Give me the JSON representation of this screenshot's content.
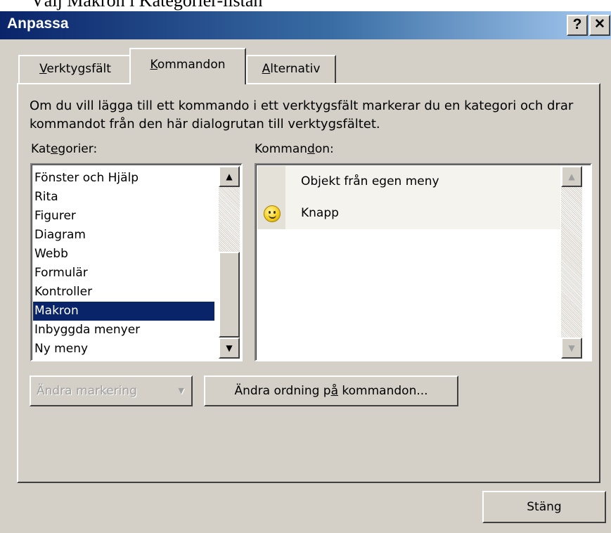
{
  "document": {
    "caption_fragment": "Välj Makron i Kategorier-listan"
  },
  "window": {
    "title": "Anpassa",
    "help_label": "?",
    "close_label": "✕"
  },
  "tabs": [
    {
      "label": "Verktygsfält",
      "accel": "V",
      "rest": "erktygsfält"
    },
    {
      "label": "Kommandon",
      "accel": "K",
      "rest": "ommandon"
    },
    {
      "label": "Alternativ",
      "accel": "A",
      "rest": "lternativ"
    }
  ],
  "active_tab": "Kommandon",
  "instruction": "Om du vill lägga till ett kommando i ett verktygsfält markerar du en kategori och drar kommandot från den här dialogrutan till verktygsfältet.",
  "categories": {
    "label_pre": "Kat",
    "label_accel": "e",
    "label_post": "gorier:",
    "items": [
      "Fönster och Hjälp",
      "Rita",
      "Figurer",
      "Diagram",
      "Webb",
      "Formulär",
      "Kontroller",
      "Makron",
      "Inbyggda menyer",
      "Ny meny"
    ],
    "selected": "Makron"
  },
  "commands": {
    "label_pre": "Komman",
    "label_accel": "d",
    "label_post": "on:",
    "items": [
      {
        "label": "Objekt från egen meny",
        "icon": "none"
      },
      {
        "label": "Knapp",
        "icon": "smiley-icon"
      }
    ]
  },
  "buttons": {
    "modify_selection": "Ändra markering",
    "modify_selection_arrow": "▼",
    "rearrange_pre": "Ändra ordning p",
    "rearrange_accel": "å",
    "rearrange_post": " kommandon...",
    "close": "Stäng"
  },
  "scroll_glyphs": {
    "up": "▲",
    "down": "▼"
  },
  "colors": {
    "face": "#d4d0c8",
    "title_start": "#0a246a",
    "title_end": "#a6caf0",
    "selection": "#0a246a"
  }
}
